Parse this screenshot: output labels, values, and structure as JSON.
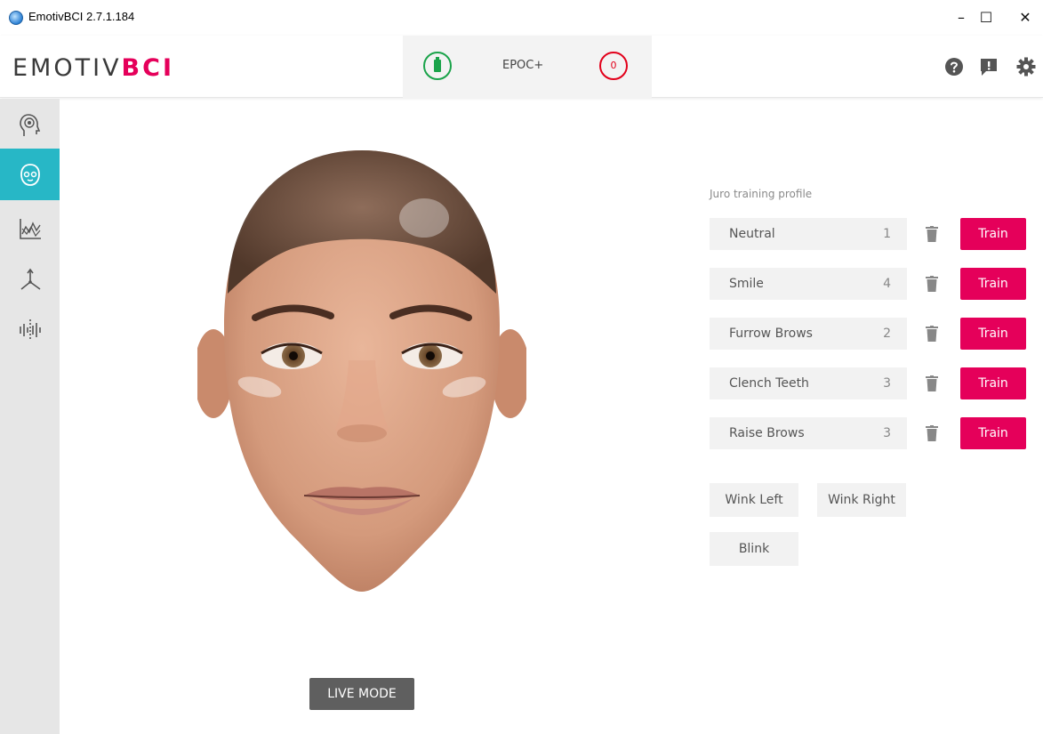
{
  "window": {
    "title": "EmotivBCI 2.7.1.184",
    "controls": [
      "–",
      "☐",
      "✕"
    ]
  },
  "header": {
    "logo_part1": "EMOTIV",
    "logo_part2": "BCI",
    "device_name": "EPOC+",
    "signal_value": "0"
  },
  "sidebar": {
    "items": [
      {
        "icon": "brain-head-icon",
        "active": false
      },
      {
        "icon": "face-head-icon",
        "active": true
      },
      {
        "icon": "performance-chart-icon",
        "active": false
      },
      {
        "icon": "motion-axis-icon",
        "active": false
      },
      {
        "icon": "waveform-icon",
        "active": false
      }
    ]
  },
  "training": {
    "profile_label": "Juro training profile",
    "train_label": "Train",
    "rows": [
      {
        "name": "Neutral",
        "count": "1"
      },
      {
        "name": "Smile",
        "count": "4"
      },
      {
        "name": "Furrow Brows",
        "count": "2"
      },
      {
        "name": "Clench Teeth",
        "count": "3"
      },
      {
        "name": "Raise Brows",
        "count": "3"
      }
    ],
    "wink_left": "Wink Left",
    "wink_right": "Wink Right",
    "blink": "Blink"
  },
  "live_mode_label": "LIVE MODE",
  "colors": {
    "accent": "#e5005a",
    "active_sidebar": "#27b7c6",
    "battery": "#1aa34a",
    "signal": "#e2001a"
  }
}
